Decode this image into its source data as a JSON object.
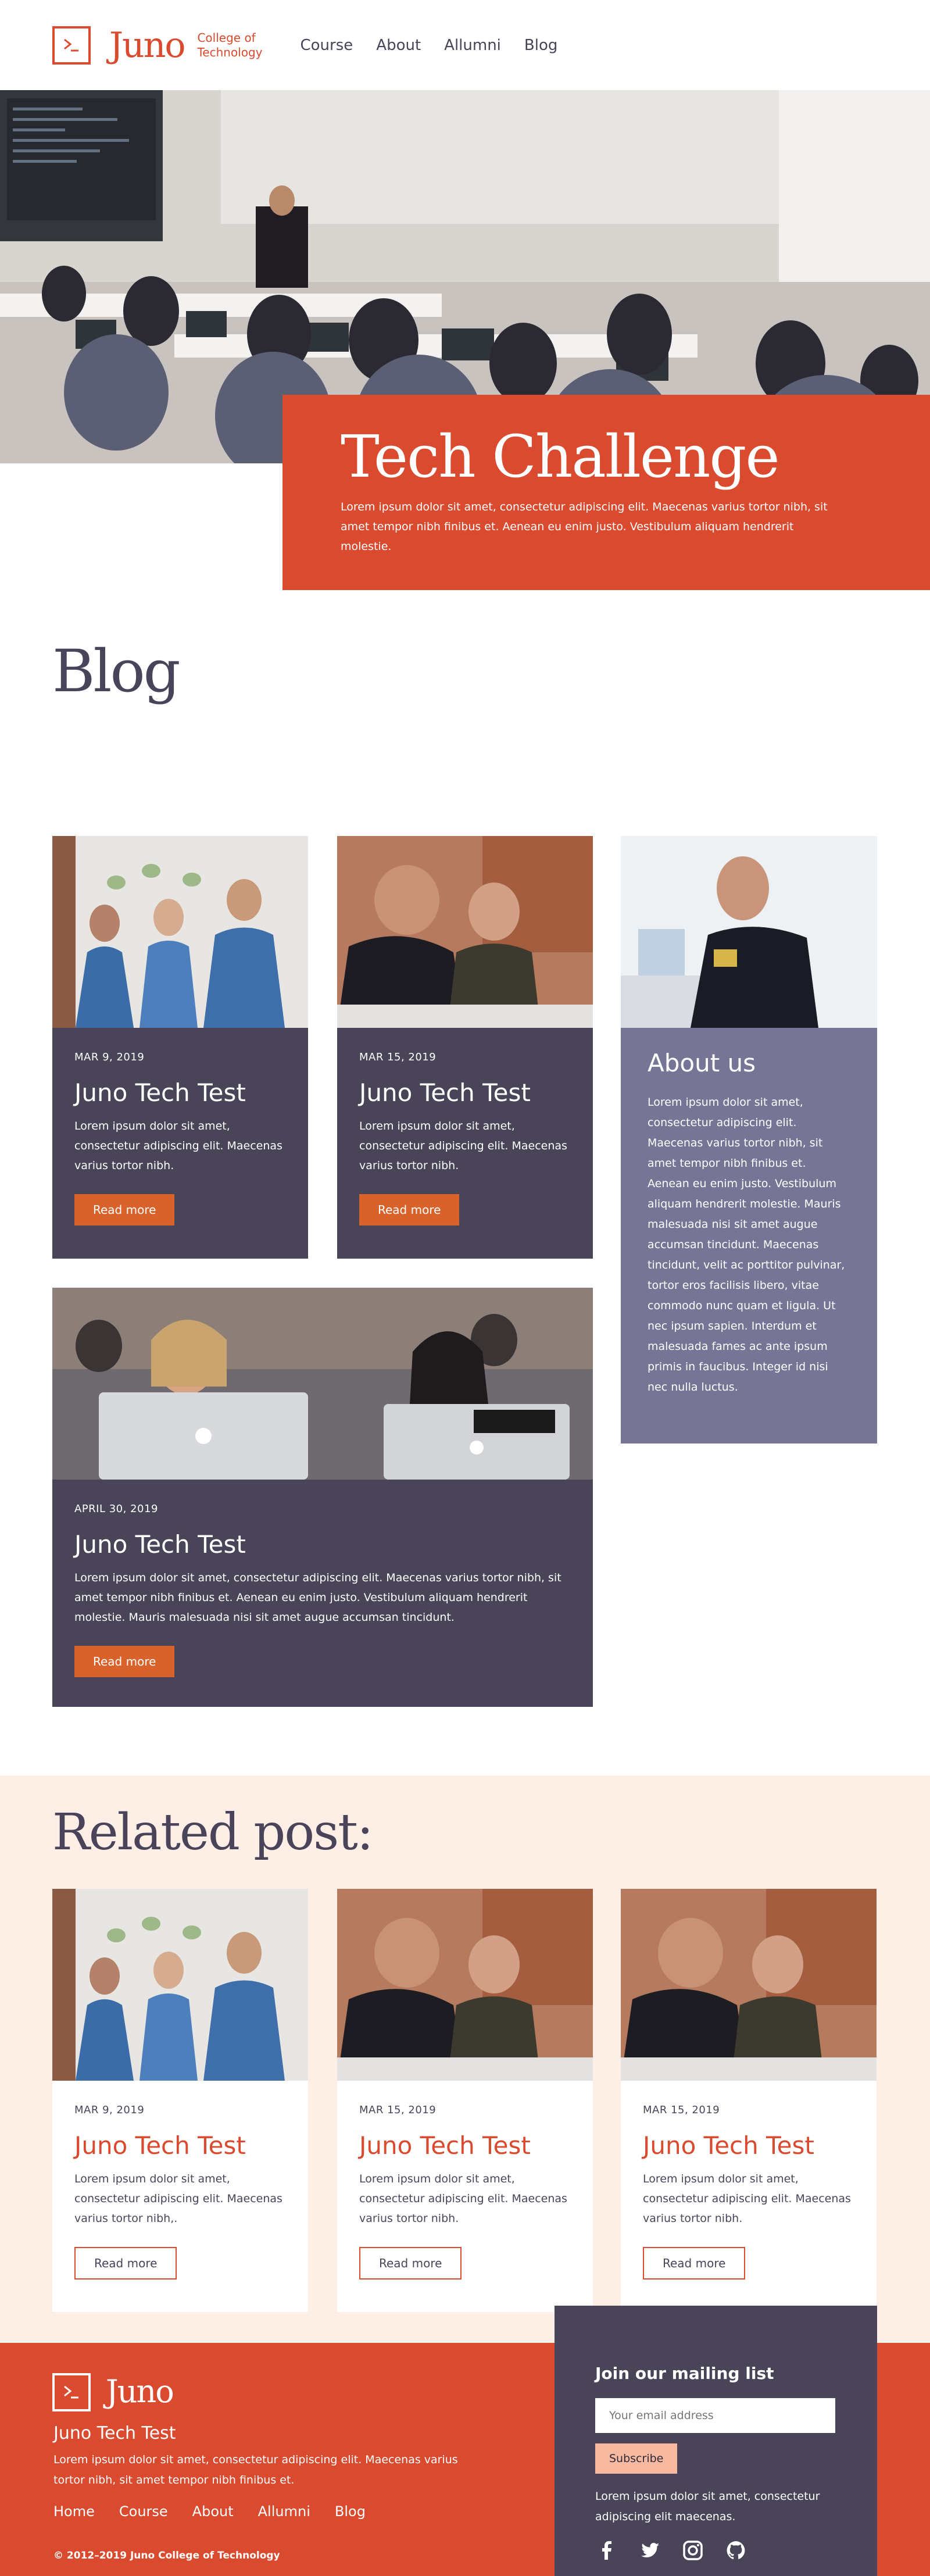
{
  "header": {
    "logo_word": "Juno",
    "logo_sub_line1": "College of",
    "logo_sub_line2": "Technology",
    "nav": [
      "Course",
      "About",
      "Allumni",
      "Blog"
    ]
  },
  "hero": {
    "title": "Tech Challenge",
    "text": "Lorem ipsum dolor sit amet, consectetur adipiscing elit. Maecenas varius tortor nibh, sit amet tempor nibh finibus et. Aenean eu enim justo. Vestibulum aliquam hendrerit molestie."
  },
  "blog": {
    "heading": "Blog",
    "cards": [
      {
        "date": "MAR 9, 2019",
        "title": "Juno Tech Test",
        "text": "Lorem ipsum dolor sit amet, consectetur adipiscing elit. Maecenas varius tortor nibh.",
        "button": "Read more"
      },
      {
        "date": "MAR 15, 2019",
        "title": "Juno Tech Test",
        "text": "Lorem ipsum dolor sit amet, consectetur adipiscing elit. Maecenas varius tortor nibh.",
        "button": "Read more"
      },
      {
        "date": "APRIL 30, 2019",
        "title": "Juno Tech Test",
        "text": "Lorem ipsum dolor sit amet, consectetur adipiscing elit. Maecenas varius tortor nibh, sit amet tempor nibh finibus et. Aenean eu enim justo. Vestibulum aliquam hendrerit molestie. Mauris malesuada nisi sit amet augue accumsan tincidunt.",
        "button": "Read more"
      }
    ],
    "about": {
      "title": "About us",
      "text": "Lorem ipsum dolor sit amet, consectetur adipiscing elit. Maecenas varius tortor nibh, sit amet tempor nibh finibus et. Aenean eu enim justo. Vestibulum aliquam hendrerit molestie. Mauris malesuada nisi sit amet augue accumsan tincidunt. Maecenas tincidunt, velit ac porttitor pulvinar, tortor eros facilisis libero, vitae commodo nunc quam et ligula. Ut nec ipsum sapien. Interdum et malesuada fames ac ante ipsum primis in faucibus. Integer id nisi nec nulla luctus."
    }
  },
  "related": {
    "heading": "Related post:",
    "cards": [
      {
        "date": "MAR 9, 2019",
        "title": "Juno Tech Test",
        "text": "Lorem ipsum dolor sit amet, consectetur adipiscing elit. Maecenas varius tortor nibh,.",
        "button": "Read more"
      },
      {
        "date": "MAR 15, 2019",
        "title": "Juno Tech Test",
        "text": "Lorem ipsum dolor sit amet, consectetur adipiscing elit. Maecenas varius tortor nibh.",
        "button": "Read more"
      },
      {
        "date": "MAR 15, 2019",
        "title": "Juno Tech Test",
        "text": "Lorem ipsum dolor sit amet, consectetur adipiscing elit. Maecenas varius tortor nibh.",
        "button": "Read more"
      }
    ]
  },
  "footer": {
    "logo_word": "Juno",
    "title": "Juno Tech Test",
    "text": "Lorem ipsum dolor sit amet, consectetur adipiscing elit. Maecenas varius tortor nibh, sit amet tempor nibh finibus et.",
    "nav": [
      "Home",
      "Course",
      "About",
      "Allumni",
      "Blog"
    ],
    "copyright": "© 2012–2019 Juno College of Technology",
    "mailing": {
      "title": "Join our mailing list",
      "placeholder": "Your email address",
      "button": "Subscribe",
      "text": "Lorem ipsum dolor sit amet, consectetur adipiscing elit maecenas."
    },
    "social": [
      "facebook-icon",
      "twitter-icon",
      "instagram-icon",
      "github-icon"
    ]
  },
  "colors": {
    "brand": "#d94a2e",
    "dark": "#4a4459",
    "about": "#767596",
    "related_bg": "#fdeee6",
    "button": "#d9622b",
    "subscribe": "#f8b9a1"
  }
}
